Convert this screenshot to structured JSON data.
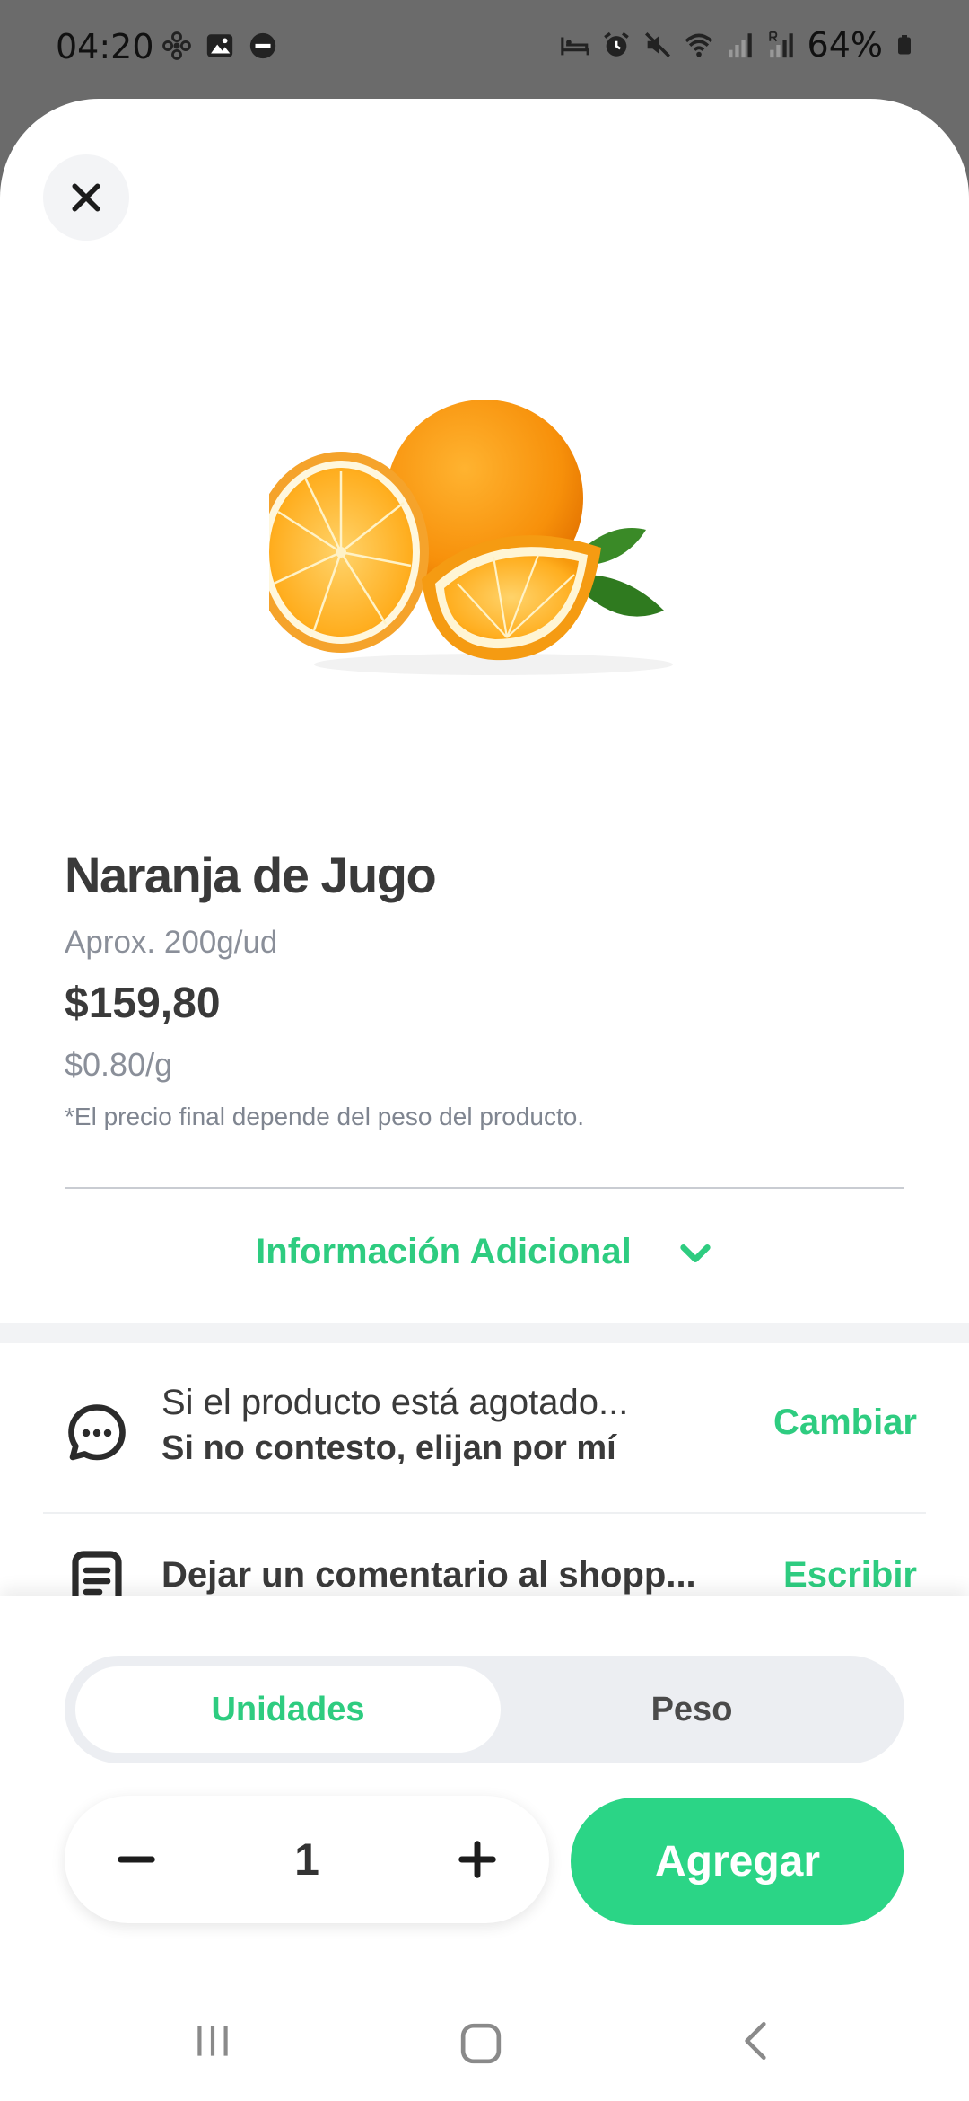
{
  "status_bar": {
    "time": "04:20",
    "battery": "64%",
    "left_icons": [
      "fan-icon",
      "image-icon",
      "dnd-icon"
    ],
    "right_icons": [
      "sleep-icon",
      "alarm-icon",
      "mute-icon",
      "wifi-icon",
      "signal-icon",
      "signal-r-icon",
      "battery-icon"
    ]
  },
  "product": {
    "name": "Naranja de Jugo",
    "approx_weight": "Aprox. 200g/ud",
    "price": "$159,80",
    "unit_price": "$0.80/g",
    "note": "*El precio final depende del peso del producto.",
    "additional_info_label": "Información Adicional"
  },
  "options": {
    "out_of_stock_question": "Si el producto está agotado...",
    "out_of_stock_choice": "Si no contesto, elijan por mí",
    "change_label": "Cambiar",
    "comment_label": "Dejar un comentario al shopp...",
    "write_label": "Escribir"
  },
  "mode_toggle": {
    "units_label": "Unidades",
    "weight_label": "Peso",
    "selected": "Unidades"
  },
  "quantity": {
    "value": "1"
  },
  "add_button_label": "Agregar",
  "colors": {
    "accent": "#2ECC80",
    "button": "#2BD586",
    "text_dark": "#3A3A3A",
    "text_muted": "#8A8F99"
  }
}
